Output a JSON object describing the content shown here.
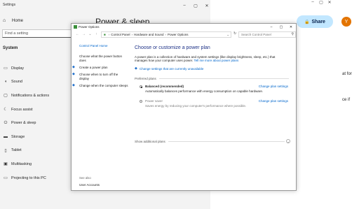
{
  "settings": {
    "title": "Settings",
    "home": "Home",
    "search_placeholder": "Find a setting",
    "section": "System",
    "nav": [
      {
        "label": "Display",
        "icon": "monitor-icon",
        "glyph": "▭"
      },
      {
        "label": "Sound",
        "icon": "speaker-icon",
        "glyph": "◖"
      },
      {
        "label": "Notifications & actions",
        "icon": "notifications-icon",
        "glyph": "▢"
      },
      {
        "label": "Focus assist",
        "icon": "moon-icon",
        "glyph": "☾"
      },
      {
        "label": "Power & sleep",
        "icon": "power-icon",
        "glyph": "⏻"
      },
      {
        "label": "Storage",
        "icon": "storage-icon",
        "glyph": "▬"
      },
      {
        "label": "Tablet",
        "icon": "tablet-icon",
        "glyph": "▯"
      },
      {
        "label": "Multitasking",
        "icon": "multitasking-icon",
        "glyph": "▣"
      },
      {
        "label": "Projecting to this PC",
        "icon": "projector-icon",
        "glyph": "▭"
      }
    ],
    "page_title": "Power & sleep"
  },
  "doc": {
    "share": "Share",
    "avatar": "Y",
    "text1": "at for",
    "text2": "ce if",
    "help": "?"
  },
  "power_options": {
    "title": "Power Options",
    "breadcrumbs": [
      "Control Panel",
      "Hardware and Sound",
      "Power Options"
    ],
    "search_placeholder": "Search Control Panel",
    "left": {
      "home": "Control Panel Home",
      "links": [
        "Choose what the power button does",
        "Create a power plan",
        "Choose when to turn off the display",
        "Change when the computer sleeps"
      ],
      "see_also": "See also",
      "user_accounts": "User Accounts"
    },
    "heading": "Choose or customize a power plan",
    "description": "A power plan is a collection of hardware and system settings (like display brightness, sleep, etc.) that manages how your computer uses power.",
    "tell_more": "Tell me more about power plans",
    "change_unavailable": "Change settings that are currently unavailable",
    "preferred_plans": "Preferred plans",
    "plans": [
      {
        "name": "Balanced (recommended)",
        "desc": "Automatically balances performance with energy consumption on capable hardware.",
        "settings": "Change plan settings",
        "selected": true
      },
      {
        "name": "Power saver",
        "desc": "Saves energy by reducing your computer's performance where possible.",
        "settings": "Change plan settings",
        "selected": false
      }
    ],
    "show_additional": "Show additional plans"
  }
}
